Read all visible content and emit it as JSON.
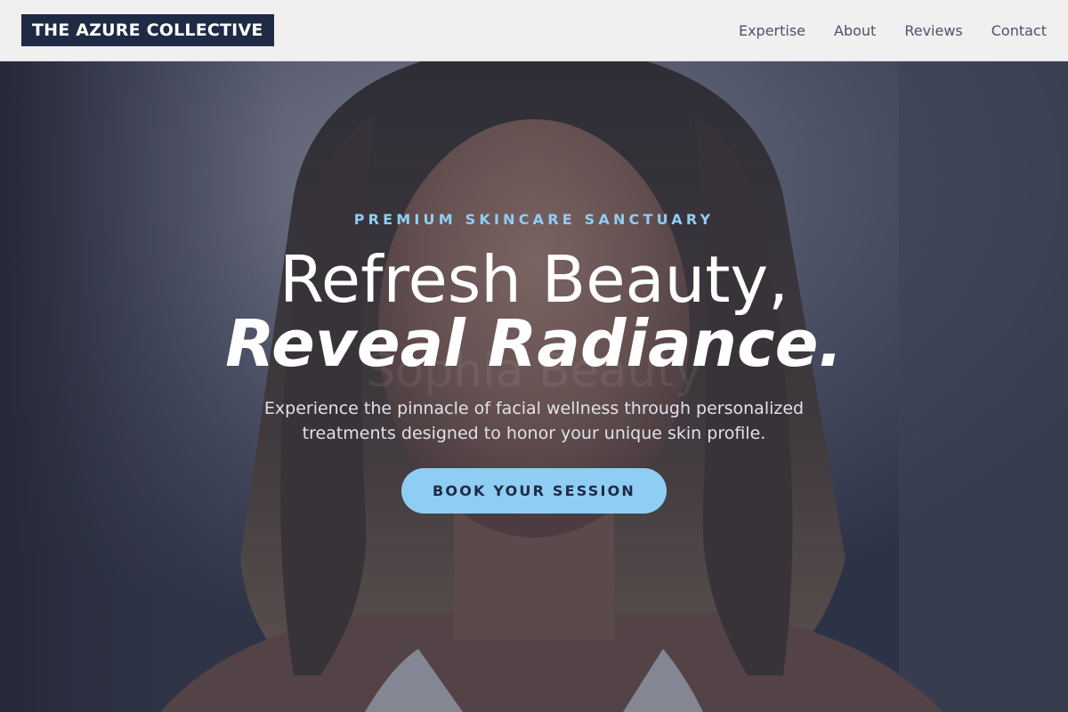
{
  "header": {
    "brand": "THE AZURE COLLECTIVE",
    "nav": [
      {
        "label": "Expertise"
      },
      {
        "label": "About"
      },
      {
        "label": "Reviews"
      },
      {
        "label": "Contact"
      }
    ]
  },
  "hero": {
    "eyebrow": "PREMIUM SKINCARE SANCTUARY",
    "headline_line1": "Refresh Beauty,",
    "headline_line2": "Reveal Radiance.",
    "ghost_text": "Sophia Beauty",
    "description": "Experience the pinnacle of facial wellness through personalized treatments designed to honor your unique skin profile.",
    "cta_label": "BOOK YOUR SESSION"
  },
  "colors": {
    "accent": "#90cdf4",
    "brand_dark": "#1f2a44",
    "header_bg": "#f0f0f1",
    "nav_text": "#4a5568"
  }
}
